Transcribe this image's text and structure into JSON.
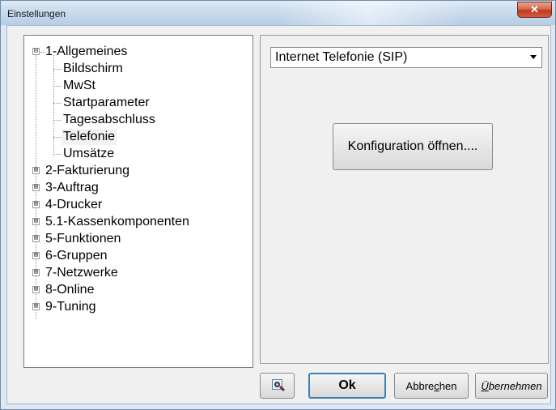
{
  "window": {
    "title": "Einstellungen",
    "close_symbol": "✕",
    "close_icon": "close-icon"
  },
  "tree": {
    "nodes": [
      {
        "label": "1-Allgemeines",
        "expanded": true,
        "toggle": "⊟",
        "children": [
          {
            "label": "Bildschirm"
          },
          {
            "label": "MwSt"
          },
          {
            "label": "Startparameter"
          },
          {
            "label": "Tagesabschluss"
          },
          {
            "label": "Telefonie",
            "selected": true
          },
          {
            "label": "Umsätze"
          }
        ]
      },
      {
        "label": "2-Fakturierung",
        "toggle": "⊞"
      },
      {
        "label": "3-Auftrag",
        "toggle": "⊞"
      },
      {
        "label": "4-Drucker",
        "toggle": "⊞"
      },
      {
        "label": "5.1-Kassenkomponenten",
        "toggle": "⊞"
      },
      {
        "label": "5-Funktionen",
        "toggle": "⊞"
      },
      {
        "label": "6-Gruppen",
        "toggle": "⊞"
      },
      {
        "label": "7-Netzwerke",
        "toggle": "⊞"
      },
      {
        "label": "8-Online",
        "toggle": "⊞"
      },
      {
        "label": "9-Tuning",
        "toggle": "⊞"
      }
    ]
  },
  "panel": {
    "dropdown_value": "Internet Telefonie (SIP)",
    "config_button": "Konfiguration öffnen...."
  },
  "buttons": {
    "preview_icon": "print-preview-icon",
    "ok": "Ok",
    "cancel_pre": "Abbre",
    "cancel_u": "c",
    "cancel_post": "hen",
    "apply_u": "Ü",
    "apply_post": "bernehmen"
  }
}
